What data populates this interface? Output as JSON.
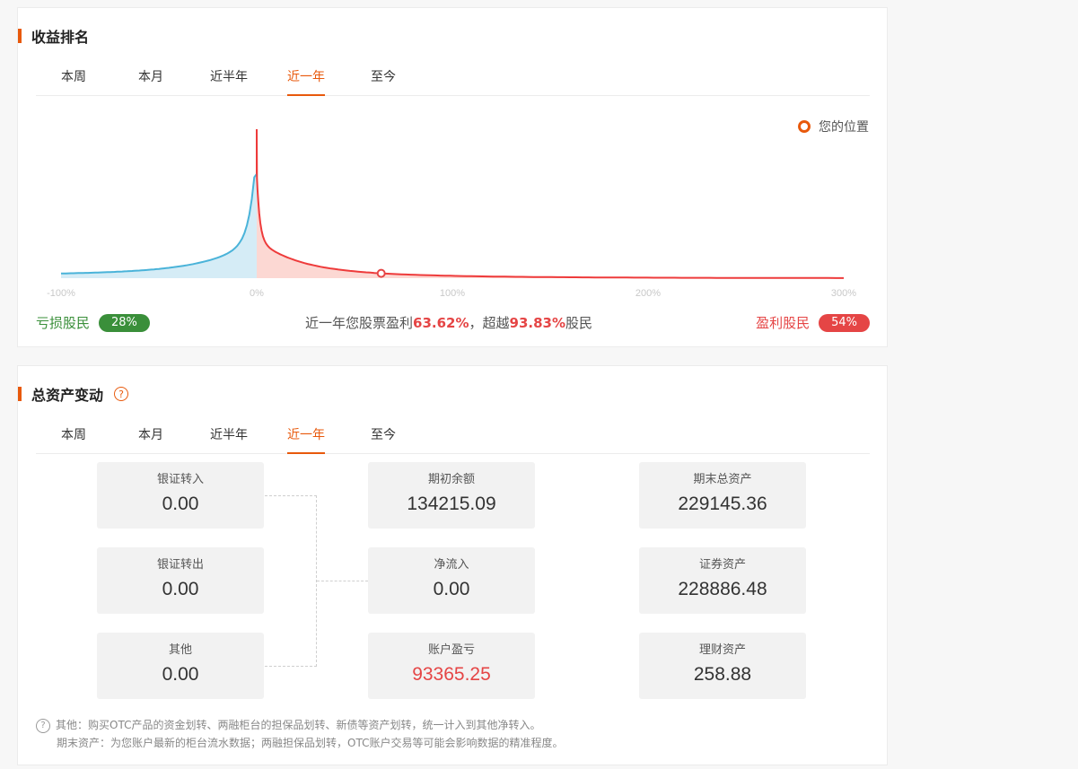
{
  "ranking": {
    "title": "收益排名",
    "tabs": [
      "本周",
      "本月",
      "近半年",
      "近一年",
      "至今"
    ],
    "active_tab": 3,
    "legend_position_label": "您的位置",
    "loss": {
      "label": "亏损股民",
      "percent": "28%",
      "color": "#3a8f3a"
    },
    "gain": {
      "label": "盈利股民",
      "percent": "54%",
      "color": "#e54545"
    },
    "summary": {
      "prefix": "近一年您股票盈利",
      "return": "63.62%",
      "middle": "，超越",
      "beat": "93.83%",
      "suffix": "股民"
    },
    "chart_data": {
      "type": "area",
      "x_ticks": [
        "-100%",
        "0%",
        "100%",
        "200%",
        "300%"
      ],
      "xlim": [
        -100,
        300
      ],
      "peak_x": 0,
      "your_position_x": 63.62,
      "colors": {
        "loss_line": "#4ab3d9",
        "loss_fill": "#d5ecf6",
        "gain_line": "#ee3b3b",
        "gain_fill": "#fcd8d3",
        "marker": "#e54545"
      }
    }
  },
  "assets": {
    "title": "总资产变动",
    "tabs": [
      "本周",
      "本月",
      "近半年",
      "近一年",
      "至今"
    ],
    "active_tab": 3,
    "cards": {
      "bank_in": {
        "label": "银证转入",
        "value": "0.00"
      },
      "bank_out": {
        "label": "银证转出",
        "value": "0.00"
      },
      "other": {
        "label": "其他",
        "value": "0.00"
      },
      "opening": {
        "label": "期初余额",
        "value": "134215.09"
      },
      "net_inflow": {
        "label": "净流入",
        "value": "0.00"
      },
      "pnl": {
        "label": "账户盈亏",
        "value": "93365.25"
      },
      "closing_total": {
        "label": "期末总资产",
        "value": "229145.36"
      },
      "securities": {
        "label": "证券资产",
        "value": "228886.48"
      },
      "wealth": {
        "label": "理财资产",
        "value": "258.88"
      }
    },
    "notes": [
      "其他：购买OTC产品的资金划转、两融柜台的担保品划转、新债等资产划转，统一计入到其他净转入。",
      "期末资产：为您账户最新的柜台流水数据；两融担保品划转，OTC账户交易等可能会影响数据的精准程度。"
    ]
  }
}
